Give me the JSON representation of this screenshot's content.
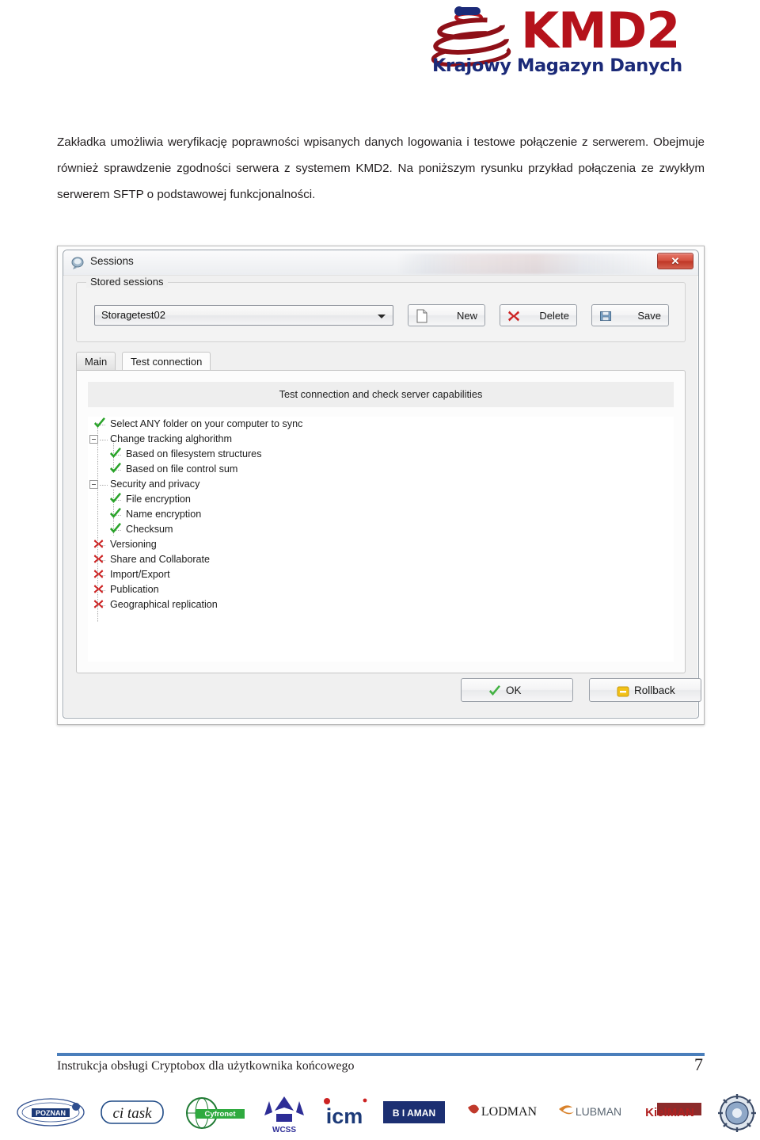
{
  "logo": {
    "title": "KMD2",
    "subtitle": "Krajowy Magazyn Danych",
    "mark_icon": "kmd2-disc-icon",
    "color_red": "#b5121b",
    "color_blue": "#1b2a78"
  },
  "document": {
    "paragraph": "Zakładka umożliwia weryfikację poprawności wpisanych danych logowania i testowe połączenie z serwerem. Obejmuje również sprawdzenie zgodności serwera z systemem KMD2. Na poniższym rysunku przykład połączenia ze zwykłym serwerem SFTP o podstawowej funkcjonalności."
  },
  "dialog": {
    "title": "Sessions",
    "title_icon": "sessions-icon",
    "close_label": "✕",
    "stored_sessions": {
      "legend": "Stored sessions",
      "combo_value": "Storagetest02",
      "buttons": [
        {
          "label": "New",
          "icon": "new-page-icon"
        },
        {
          "label": "Delete",
          "icon": "red-x-icon"
        },
        {
          "label": "Save",
          "icon": "save-disk-icon"
        }
      ]
    },
    "tabs": [
      {
        "label": "Main",
        "active": false
      },
      {
        "label": "Test connection",
        "active": true
      }
    ],
    "panel_header": "Test connection and check server capabilities",
    "tree": [
      {
        "label": "Select ANY folder on your computer to sync",
        "level": 0,
        "icon": "green-check-icon"
      },
      {
        "label": "Change tracking alghorithm",
        "level": 0,
        "icon": "expander-minus-icon"
      },
      {
        "label": "Based on filesystem structures",
        "level": 1,
        "icon": "green-check-icon"
      },
      {
        "label": "Based on file control sum",
        "level": 1,
        "icon": "green-check-icon"
      },
      {
        "label": "Security and privacy",
        "level": 0,
        "icon": "expander-minus-icon"
      },
      {
        "label": "File encryption",
        "level": 1,
        "icon": "green-check-icon"
      },
      {
        "label": "Name encryption",
        "level": 1,
        "icon": "green-check-icon"
      },
      {
        "label": "Checksum",
        "level": 1,
        "icon": "green-check-icon"
      },
      {
        "label": "Versioning",
        "level": 0,
        "icon": "red-x-icon"
      },
      {
        "label": "Share and Collaborate",
        "level": 0,
        "icon": "red-x-icon"
      },
      {
        "label": "Import/Export",
        "level": 0,
        "icon": "red-x-icon"
      },
      {
        "label": "Publication",
        "level": 0,
        "icon": "red-x-icon"
      },
      {
        "label": "Geographical replication",
        "level": 0,
        "icon": "red-x-icon"
      }
    ],
    "footer_buttons": [
      {
        "label": "OK",
        "icon": "green-check-icon"
      },
      {
        "label": "Rollback",
        "icon": "yellow-minus-icon"
      }
    ]
  },
  "page_footer": {
    "text": "Instrukcja obsługi Cryptobox dla użytkownika końcowego",
    "page_number": "7",
    "rule_color": "#4a7ebb"
  },
  "sponsor_logos": [
    {
      "name": "poznan-logo",
      "text": "POZNAN"
    },
    {
      "name": "ci-task-logo",
      "text": "ci task"
    },
    {
      "name": "cyfronet-logo",
      "text": "Cyfronet"
    },
    {
      "name": "wcss-logo",
      "text": "WCSS"
    },
    {
      "name": "icm-logo",
      "text": "icm"
    },
    {
      "name": "biaman-logo",
      "text": "B I AMAN"
    },
    {
      "name": "lodman-logo",
      "text": "LODMAN"
    },
    {
      "name": "lubman-logo",
      "text": "LUBMAN"
    },
    {
      "name": "kielman-logo",
      "text": "KielMAN"
    },
    {
      "name": "seal-logo",
      "text": ""
    }
  ]
}
